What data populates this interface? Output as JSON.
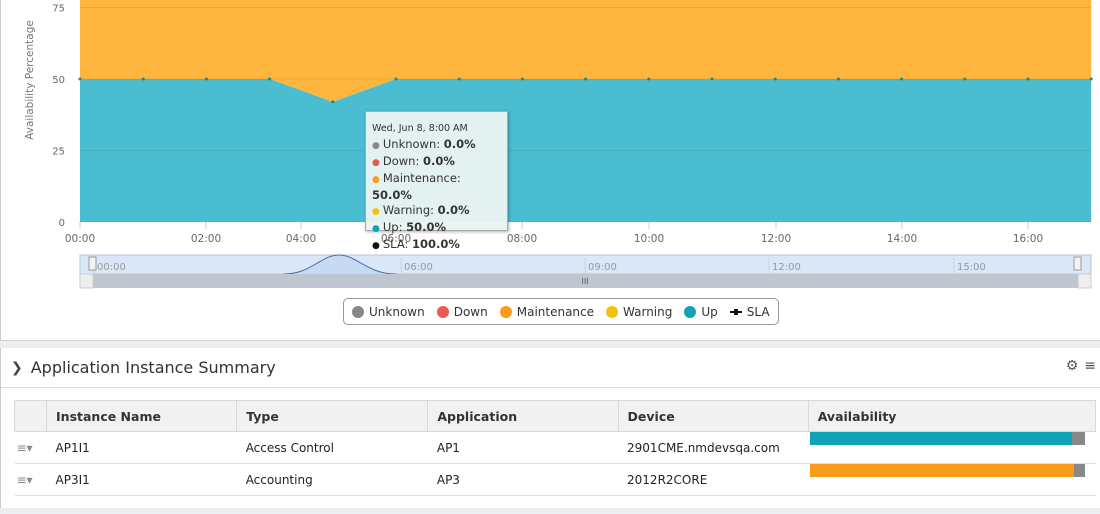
{
  "chart_data": {
    "type": "area",
    "ylabel": "Availability Percentage",
    "yticks": [
      0,
      25,
      50,
      75
    ],
    "ylim": [
      0,
      77
    ],
    "xticks": [
      "00:00",
      "02:00",
      "04:00",
      "06:00",
      "08:00",
      "10:00",
      "12:00",
      "14:00",
      "16:00"
    ],
    "x_hours": [
      0,
      1,
      2,
      3,
      4,
      5,
      6,
      7,
      8,
      9,
      10,
      11,
      12,
      13,
      14,
      15,
      16
    ],
    "series": [
      {
        "name": "Up",
        "color": "#4bbdd1",
        "values": [
          50,
          50,
          50,
          50,
          42,
          50,
          50,
          50,
          50,
          50,
          50,
          50,
          50,
          50,
          50,
          50,
          50
        ]
      },
      {
        "name": "Maintenance",
        "color": "#fdb53e",
        "values": [
          50,
          50,
          50,
          50,
          58,
          50,
          50,
          50,
          50,
          50,
          50,
          50,
          50,
          50,
          50,
          50,
          50
        ]
      }
    ],
    "navigator_ticks": [
      "00:00",
      "06:00",
      "09:00",
      "12:00",
      "15:00"
    ],
    "tooltip": {
      "header": "Wed, Jun 8, 8:00 AM",
      "rows": [
        {
          "label": "Unknown:",
          "value": "0.0%",
          "color": "#888888"
        },
        {
          "label": "Down:",
          "value": "0.0%",
          "color": "#e8584f"
        },
        {
          "label": "Maintenance:",
          "value": "50.0%",
          "color": "#f99b1c"
        },
        {
          "label": "Warning:",
          "value": "0.0%",
          "color": "#f4c20d"
        },
        {
          "label": "Up:",
          "value": "50.0%",
          "color": "#0fa3b5"
        },
        {
          "label": "SLA:",
          "value": "100.0%",
          "color": "#111111"
        }
      ]
    },
    "legend": [
      {
        "label": "Unknown",
        "color": "#888888"
      },
      {
        "label": "Down",
        "color": "#ee5a52"
      },
      {
        "label": "Maintenance",
        "color": "#f99b1c"
      },
      {
        "label": "Warning",
        "color": "#f4c20d"
      },
      {
        "label": "Up",
        "color": "#0fa3b5"
      },
      {
        "label": "SLA",
        "color": "#111111"
      }
    ]
  },
  "panel": {
    "title": "Application Instance Summary",
    "columns": [
      "Instance Name",
      "Type",
      "Application",
      "Device",
      "Availability"
    ],
    "rows": [
      {
        "name": "AP1I1",
        "type": "Access Control",
        "application": "AP1",
        "device": "2901CME.nmdevsqa.com",
        "availability": {
          "up": 95,
          "maintenance": 0,
          "unknown": 5
        }
      },
      {
        "name": "AP3I1",
        "type": "Accounting",
        "application": "AP3",
        "device": "2012R2CORE",
        "availability": {
          "up": 0,
          "maintenance": 96,
          "unknown": 4
        }
      }
    ]
  }
}
